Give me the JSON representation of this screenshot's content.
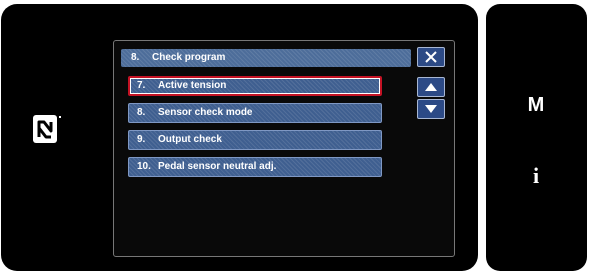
{
  "title_bar": {
    "number": "8.",
    "label": "Check program"
  },
  "menu": {
    "items": [
      {
        "number": "7.",
        "label": "Active tension",
        "selected": true
      },
      {
        "number": "8.",
        "label": "Sensor check mode",
        "selected": false
      },
      {
        "number": "9.",
        "label": "Output check",
        "selected": false
      },
      {
        "number": "10.",
        "label": "Pedal sensor neutral adj.",
        "selected": false
      }
    ]
  },
  "side_panel": {
    "m_label": "M",
    "info_label": "i"
  },
  "icons": {
    "close": "close-icon",
    "scroll_up": "arrow-up-icon",
    "scroll_down": "arrow-down-icon",
    "nfc": "nfc-icon"
  },
  "colors": {
    "bezel": "#000000",
    "item_bg": "#3f5f90",
    "button_bg": "#2c4a86",
    "selection_border": "#c41224"
  }
}
